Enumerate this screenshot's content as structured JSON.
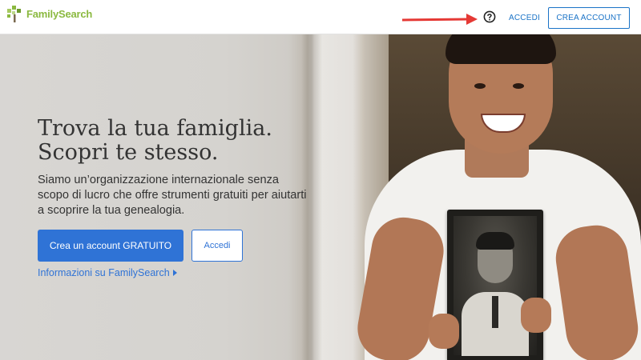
{
  "header": {
    "logo_text": "FamilySearch",
    "help_icon": "question-circle-icon",
    "signin_label": "ACCEDI",
    "create_account_label": "CREA ACCOUNT",
    "annotation_arrow_color": "#e53935"
  },
  "hero": {
    "title_line1": "Trova la tua famiglia.",
    "title_line2": "Scopri te stesso.",
    "subtitle": "Siamo un’organizzazione internazionale senza scopo di lucro che offre strumenti gratuiti per aiutarti a scoprire la tua genealogia.",
    "primary_button": "Crea un account GRATUITO",
    "secondary_button": "Accedi",
    "info_link": "Informazioni su FamilySearch"
  },
  "colors": {
    "brand_green": "#8bb940",
    "link_blue": "#1a73c7",
    "button_blue": "#2f73d6"
  }
}
